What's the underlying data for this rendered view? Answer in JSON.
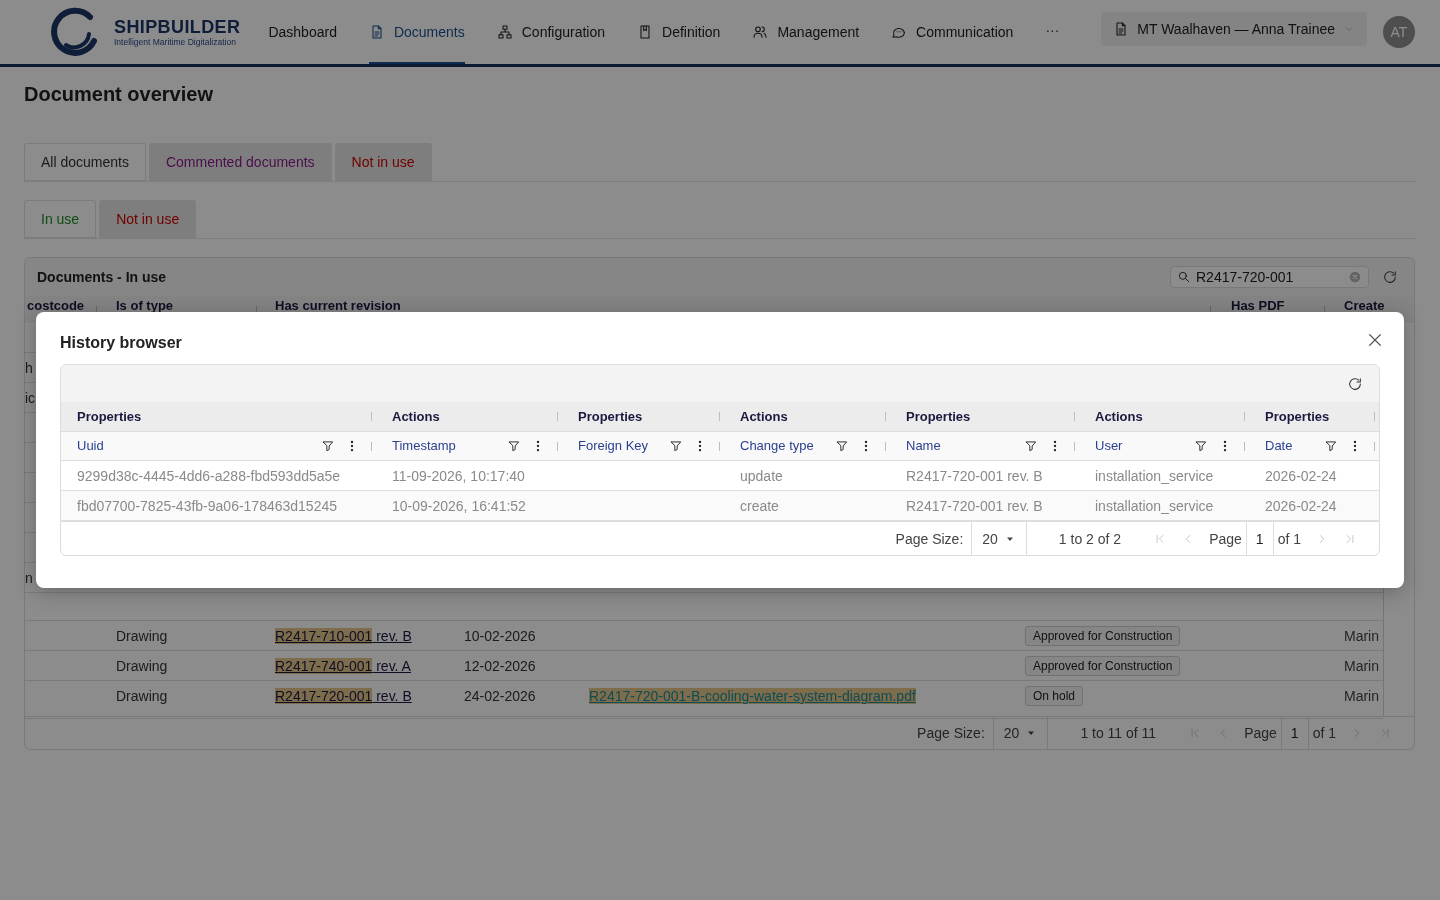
{
  "header": {
    "brand": "SHIPBUILDER",
    "tagline": "Intelligent Maritime Digitalization",
    "nav": [
      {
        "label": "Dashboard",
        "selected": false
      },
      {
        "label": "Documents",
        "selected": true
      },
      {
        "label": "Configuration",
        "selected": false
      },
      {
        "label": "Definition",
        "selected": false
      },
      {
        "label": "Management",
        "selected": false
      },
      {
        "label": "Communication",
        "selected": false
      }
    ],
    "more": "···",
    "context": "MT Waalhaven — Anna Trainee",
    "avatar": "AT"
  },
  "page": {
    "title": "Document overview"
  },
  "tabs": [
    {
      "label": "All documents",
      "selected": true,
      "kind": "all"
    },
    {
      "label": "Commented documents",
      "selected": false,
      "kind": "commented"
    },
    {
      "label": "Not in use",
      "selected": false,
      "kind": "unused"
    }
  ],
  "subtabs": [
    {
      "label": "In use",
      "selected": true,
      "kind": "used"
    },
    {
      "label": "Not in use",
      "selected": false,
      "kind": "unused"
    }
  ],
  "grid": {
    "title": "Documents - In use",
    "search": "R2417-720-001",
    "columns": [
      "costcode",
      "Is of type",
      "Has current revision",
      "Has PDF",
      "Create"
    ],
    "hidden_rows": [
      {
        "costcode": "h"
      },
      {
        "costcode": "ic"
      },
      {
        "costcode": "n"
      }
    ],
    "rows": [
      {
        "type": "Drawing",
        "revision_id": "R2417-710-001",
        "revision": "rev. B",
        "date": "10-02-2026",
        "status": "Approved for Construction",
        "create": "Marin"
      },
      {
        "type": "Drawing",
        "revision_id": "R2417-740-001",
        "revision": "rev. A",
        "date": "12-02-2026",
        "status": "Approved for Construction",
        "create": "Marin"
      },
      {
        "type": "Drawing",
        "revision_id": "R2417-720-001",
        "revision": "rev. B",
        "date": "24-02-2026",
        "pdf": "R2417-720-001-B-cooling-water-system-diagram.pdf",
        "status": "On hold",
        "create": "Marin"
      }
    ],
    "pager": {
      "size_label": "Page Size:",
      "size": "20",
      "range": "1 to 11 of 11",
      "page_label": "Page",
      "page": "1",
      "total": "of 1"
    }
  },
  "dialog": {
    "title": "History browser",
    "columns": [
      {
        "group": "Properties",
        "label": "Uuid"
      },
      {
        "group": "Actions",
        "label": "Timestamp"
      },
      {
        "group": "Properties",
        "label": "Foreign Key"
      },
      {
        "group": "Actions",
        "label": "Change type"
      },
      {
        "group": "Properties",
        "label": "Name"
      },
      {
        "group": "Actions",
        "label": "User"
      },
      {
        "group": "Properties",
        "label": "Date"
      }
    ],
    "rows": [
      [
        "9299d38c-4445-4dd6-a288-fbd593dd5a5e",
        "11-09-2026, 10:17:40",
        null,
        "update",
        "R2417-720-001 rev. B",
        "installation_service",
        "2026-02-24"
      ],
      [
        "fbd07700-7825-43fb-9a06-178463d15245",
        "10-09-2026, 16:41:52",
        null,
        "create",
        "R2417-720-001 rev. B",
        "installation_service",
        "2026-02-24"
      ]
    ],
    "pager": {
      "size_label": "Page Size:",
      "size": "20",
      "range": "1 to 2 of 2",
      "page_label": "Page",
      "page": "1",
      "total": "of 1"
    }
  }
}
